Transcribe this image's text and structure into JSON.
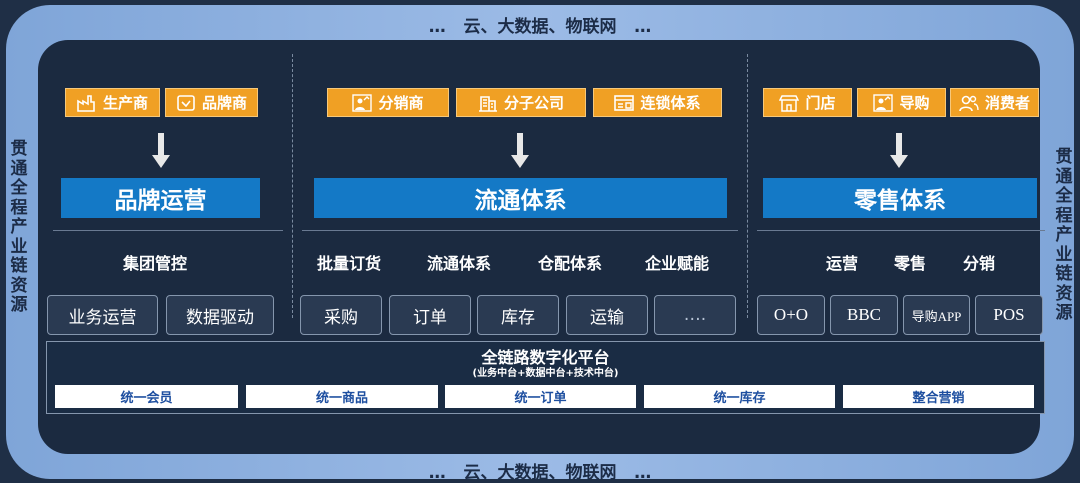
{
  "band": {
    "top": "…   云、大数据、物联网   …",
    "bottom": "…   云、大数据、物联网   …"
  },
  "side": {
    "left": "贯通全程产业链资源",
    "right": "贯通全程产业链资源"
  },
  "brand": {
    "roles": [
      "生产商",
      "品牌商"
    ],
    "title": "品牌运营",
    "capabilities": [
      "集团管控"
    ],
    "modules": [
      "业务运营",
      "数据驱动"
    ]
  },
  "circulation": {
    "roles": [
      "分销商",
      "分子公司",
      "连锁体系"
    ],
    "title": "流通体系",
    "capabilities": [
      "批量订货",
      "流通体系",
      "仓配体系",
      "企业赋能"
    ],
    "modules": [
      "采购",
      "订单",
      "库存",
      "运输",
      "…."
    ]
  },
  "retail": {
    "roles": [
      "门店",
      "导购",
      "消费者"
    ],
    "title": "零售体系",
    "capabilities": [
      "运营",
      "零售",
      "分销"
    ],
    "modules": [
      "O+O",
      "BBC",
      "导购APP",
      "POS"
    ]
  },
  "platform": {
    "title": "全链路数字化平台",
    "subtitle": "(业务中台+数据中台+技术中台)",
    "items": [
      "统一会员",
      "统一商品",
      "统一订单",
      "统一库存",
      "整合营销"
    ]
  },
  "colors": {
    "background": "#1f2f46",
    "frame": "#8fb0e0",
    "panel": "#1b2a40",
    "role_box": "#f0a024",
    "title_bar": "#1479c6"
  }
}
